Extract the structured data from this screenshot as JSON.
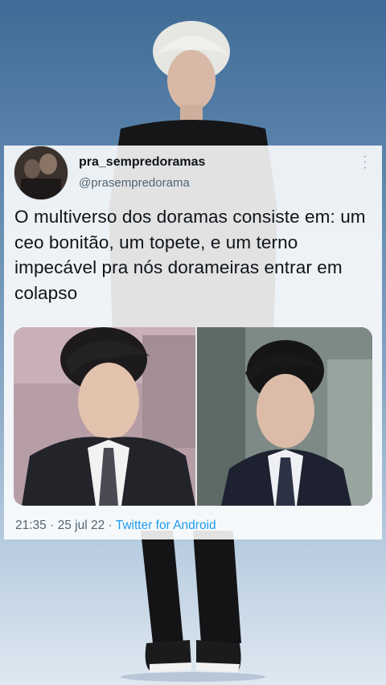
{
  "tweet": {
    "display_name": "pra_sempredoramas",
    "handle": "@prasempredorama",
    "text": "O multiverso dos doramas consiste em: um ceo bonitão, um topete, e um terno impecável pra nós dorameiras entrar em colapso",
    "time": "21:35",
    "separator": "·",
    "date": "25 jul 22",
    "separator2": "·",
    "source": "Twitter for Android"
  },
  "colors": {
    "name": "#0f1419",
    "muted": "#536471",
    "link": "#1d9bf0"
  }
}
